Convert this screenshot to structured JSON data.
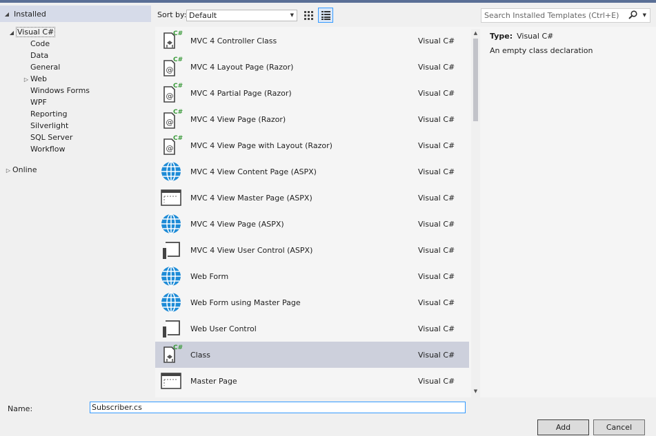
{
  "tree": {
    "installed": "Installed",
    "items": [
      {
        "label": "Visual C#",
        "level": 1,
        "expander": "expanded",
        "selected": true
      },
      {
        "label": "Code",
        "level": 2,
        "expander": "none"
      },
      {
        "label": "Data",
        "level": 2,
        "expander": "none"
      },
      {
        "label": "General",
        "level": 2,
        "expander": "none"
      },
      {
        "label": "Web",
        "level": 2,
        "expander": "collapsed"
      },
      {
        "label": "Windows Forms",
        "level": 2,
        "expander": "none"
      },
      {
        "label": "WPF",
        "level": 2,
        "expander": "none"
      },
      {
        "label": "Reporting",
        "level": 2,
        "expander": "none"
      },
      {
        "label": "Silverlight",
        "level": 2,
        "expander": "none"
      },
      {
        "label": "SQL Server",
        "level": 2,
        "expander": "none"
      },
      {
        "label": "Workflow",
        "level": 2,
        "expander": "none"
      }
    ],
    "online": "Online"
  },
  "toolbar": {
    "sort_label": "Sort by:",
    "sort_value": "Default",
    "search_placeholder": "Search Installed Templates (Ctrl+E)"
  },
  "templates": [
    {
      "name": "MVC 4 Controller Class",
      "lang": "Visual C#",
      "icon": "cs-class-icon"
    },
    {
      "name": "MVC 4 Layout Page (Razor)",
      "lang": "Visual C#",
      "icon": "razor-page-icon"
    },
    {
      "name": "MVC 4 Partial Page (Razor)",
      "lang": "Visual C#",
      "icon": "razor-page-icon"
    },
    {
      "name": "MVC 4 View Page (Razor)",
      "lang": "Visual C#",
      "icon": "razor-page-icon"
    },
    {
      "name": "MVC 4 View Page with Layout (Razor)",
      "lang": "Visual C#",
      "icon": "razor-page-icon"
    },
    {
      "name": "MVC 4 View Content Page (ASPX)",
      "lang": "Visual C#",
      "icon": "globe-icon"
    },
    {
      "name": "MVC 4 View Master Page (ASPX)",
      "lang": "Visual C#",
      "icon": "master-page-icon"
    },
    {
      "name": "MVC 4 View Page (ASPX)",
      "lang": "Visual C#",
      "icon": "globe-icon"
    },
    {
      "name": "MVC 4 View User Control (ASPX)",
      "lang": "Visual C#",
      "icon": "user-control-icon"
    },
    {
      "name": "Web Form",
      "lang": "Visual C#",
      "icon": "globe-icon"
    },
    {
      "name": "Web Form using Master Page",
      "lang": "Visual C#",
      "icon": "globe-icon"
    },
    {
      "name": "Web User Control",
      "lang": "Visual C#",
      "icon": "user-control-icon"
    },
    {
      "name": "Class",
      "lang": "Visual C#",
      "icon": "cs-class-icon",
      "selected": true
    },
    {
      "name": "Master Page",
      "lang": "Visual C#",
      "icon": "master-page-icon"
    }
  ],
  "info": {
    "type_label": "Type:",
    "type_value": "Visual C#",
    "description": "An empty class declaration"
  },
  "bottom": {
    "name_label": "Name:",
    "name_value": "Subscriber.cs",
    "add_label": "Add",
    "cancel_label": "Cancel"
  },
  "colors": {
    "accent": "#3399ff",
    "selected_row": "#cdd0dc",
    "header_bg": "#d6dbe9",
    "globe": "#1e8bd6",
    "csharp_green": "#3a9a3a"
  }
}
